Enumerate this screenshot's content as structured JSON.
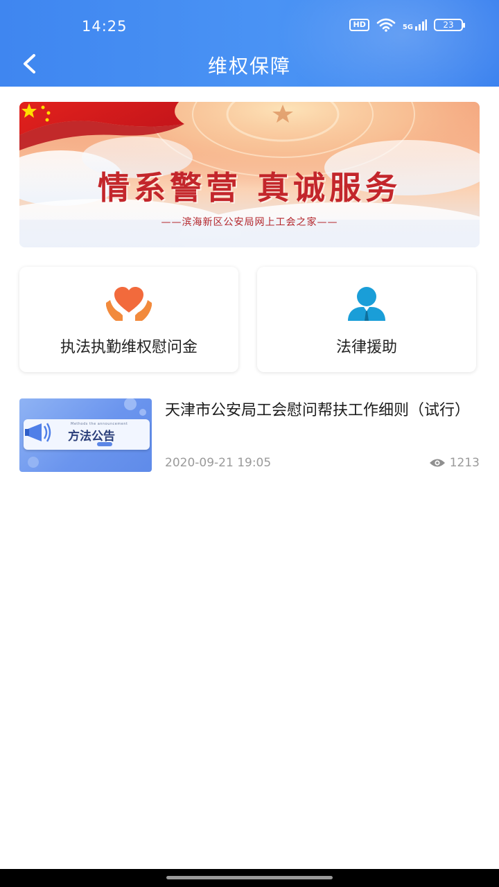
{
  "status_bar": {
    "time": "14:25",
    "network": "5G",
    "hd_label": "HD",
    "battery": "23"
  },
  "nav": {
    "title": "维权保障",
    "back_icon": "chevron-left-icon"
  },
  "banner": {
    "slogan": "情系警营  真诚服务",
    "subtitle": "——滨海新区公安局网上工会之家——"
  },
  "cards": [
    {
      "label": "执法执勤维权慰问金",
      "icon": "heart-hands-icon",
      "icon_color": "#f26a3c"
    },
    {
      "label": "法律援助",
      "icon": "person-icon",
      "icon_color": "#1a9ed8"
    }
  ],
  "articles": [
    {
      "title": "天津市公安局工会慰问帮扶工作细则（试行）",
      "date": "2020-09-21 19:05",
      "views": "1213",
      "thumb_title": "方法公告",
      "thumb_small": "Methods the announcement"
    }
  ],
  "colors": {
    "header": "#4a8ff2",
    "text": "#222222",
    "meta": "#9a9a9a"
  }
}
